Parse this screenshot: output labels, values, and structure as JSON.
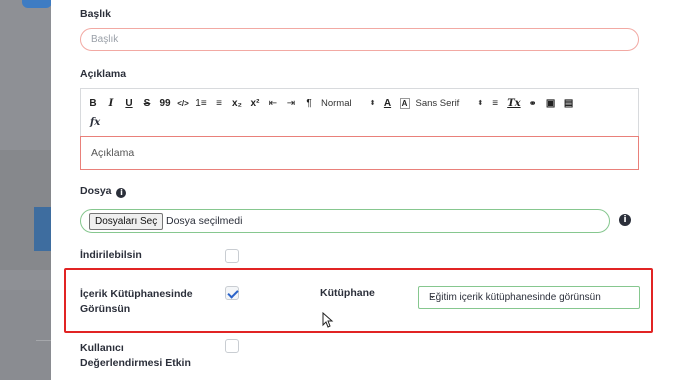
{
  "form": {
    "title_label": "Başlık",
    "title_placeholder": "Başlık",
    "description_label": "Açıklama",
    "description_placeholder": "Açıklama",
    "file_label": "Dosya",
    "file_button": "Dosyaları Seç",
    "file_status": "Dosya seçilmedi",
    "downloadable_label": "İndirilebilsin",
    "library_visible_label_line1": "İçerik Kütüphanesinde",
    "library_visible_label_line2": "Görünsün",
    "library_label": "Kütüphane",
    "library_selected": "Eğitim içerik kütüphanesinde görünsün",
    "user_rating_label_line1": "Kullanıcı",
    "user_rating_label_line2": "Değerlendirmesi Etkin"
  },
  "checkboxes": {
    "downloadable": false,
    "library_visible": true,
    "user_rating": false
  },
  "toolbar": {
    "bold": "B",
    "italic": "I",
    "underline": "U",
    "strike": "S",
    "quote": "99",
    "code": "</>",
    "ordered_list": "1≡",
    "bullet_list": "≡",
    "subscript": "x₂",
    "superscript": "x²",
    "outdent": "⇤",
    "indent": "⇥",
    "rtl": "¶",
    "header_select": "Normal",
    "font_color": "A",
    "background": "A",
    "font_select": "Sans Serif",
    "align": "≡",
    "clean": "Tx",
    "link": "🔗",
    "image": "▣",
    "video": "▤",
    "formula": "fx"
  },
  "colors": {
    "error_border": "#e9807a",
    "valid_border": "#86c78f",
    "highlight_frame": "#e12424",
    "check_color": "#2b63c9"
  }
}
